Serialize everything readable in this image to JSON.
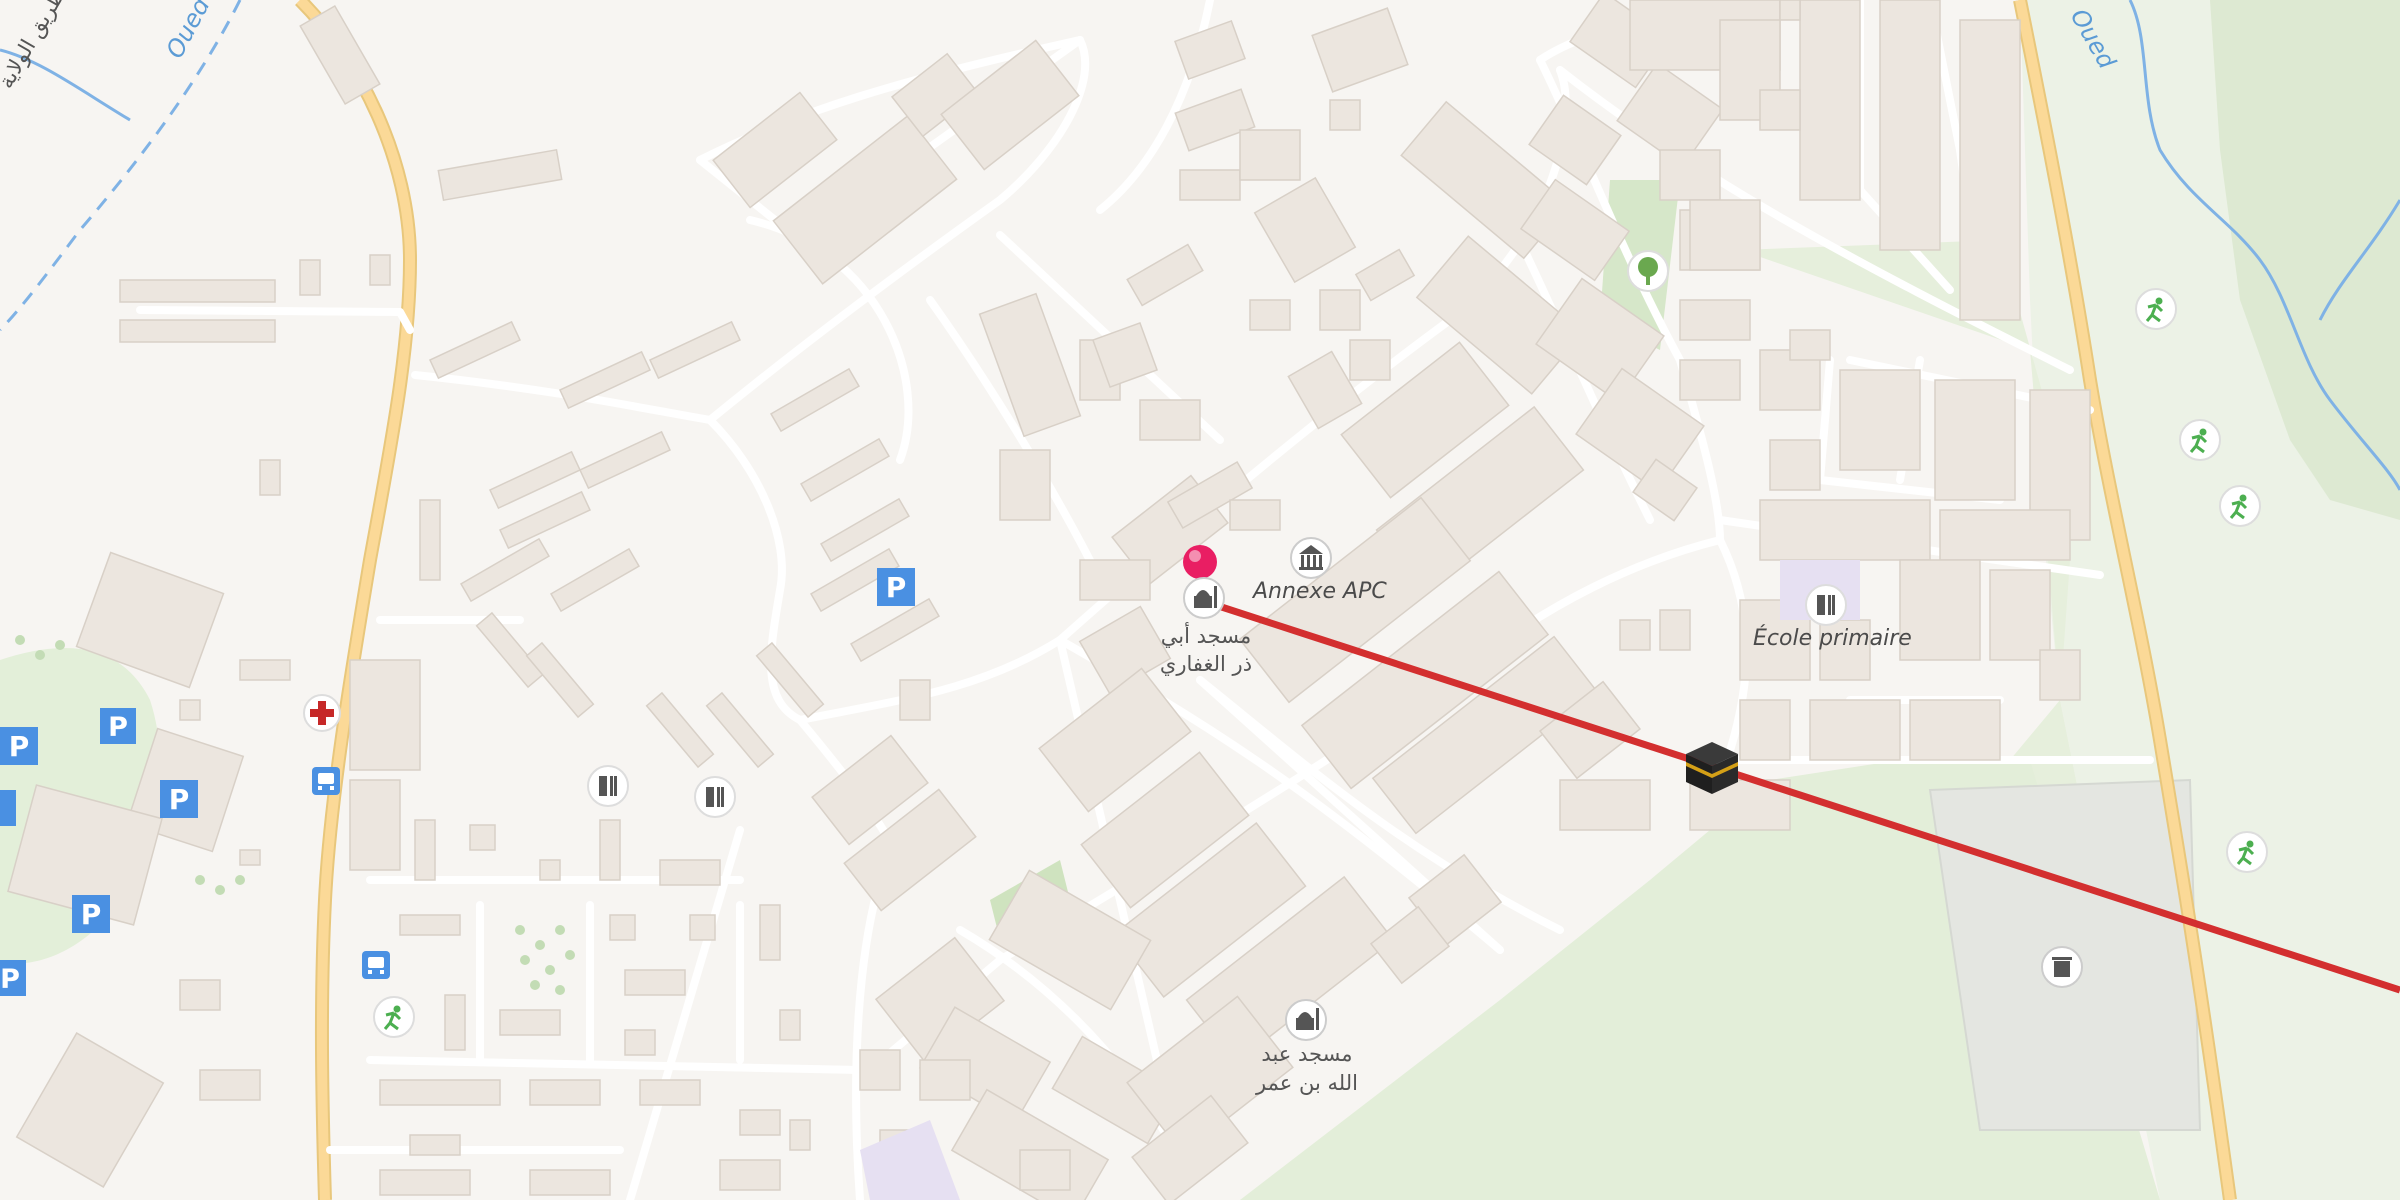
{
  "map": {
    "labels": {
      "annexe_apc": "Annexe APC",
      "ecole_primaire": "École primaire",
      "mosque_1_line1": "مسجد أبي",
      "mosque_1_line2": "ذر الغفاري",
      "mosque_2_line1": "مسجد عبد",
      "mosque_2_line2": "الله بن عمر",
      "oued_left": "Oued",
      "oued_right": "Oued",
      "road_top_left": "طريق الولاية"
    },
    "icons": {
      "pin": "location-pin-icon",
      "kaaba": "kaaba-icon",
      "qibla_line_color": "#d32f2f",
      "pin_color": "#e91e63",
      "parking_color": "#4a90e2",
      "bus_color": "#4a90e2",
      "sport_color": "#4caf50",
      "park_color": "#6aa84f"
    }
  }
}
